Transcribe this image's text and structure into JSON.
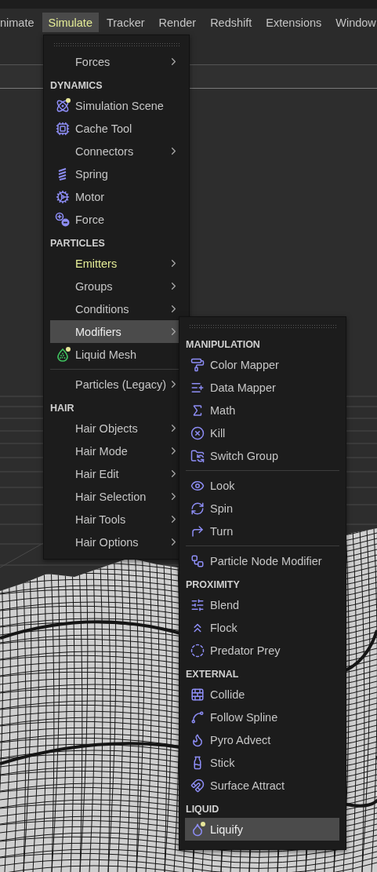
{
  "menubar": [
    {
      "label": "nimate",
      "selected": false
    },
    {
      "label": "Simulate",
      "selected": true
    },
    {
      "label": "Tracker",
      "selected": false
    },
    {
      "label": "Render",
      "selected": false
    },
    {
      "label": "Redshift",
      "selected": false
    },
    {
      "label": "Extensions",
      "selected": false
    },
    {
      "label": "Window",
      "selected": false
    }
  ],
  "simulate_menu": {
    "entries": [
      {
        "kind": "grip"
      },
      {
        "kind": "item",
        "label": "Forces",
        "submenu": true,
        "selected": false,
        "highlighted": false
      },
      {
        "kind": "header",
        "label": "DYNAMICS"
      },
      {
        "kind": "item",
        "label": "Simulation Scene",
        "submenu": false,
        "selected": false,
        "highlighted": false
      },
      {
        "kind": "item",
        "label": "Cache Tool",
        "submenu": false,
        "selected": false,
        "highlighted": false
      },
      {
        "kind": "item",
        "label": "Connectors",
        "submenu": true,
        "selected": false,
        "highlighted": false
      },
      {
        "kind": "item",
        "label": "Spring",
        "submenu": false,
        "selected": false,
        "highlighted": false
      },
      {
        "kind": "item",
        "label": "Motor",
        "submenu": false,
        "selected": false,
        "highlighted": false
      },
      {
        "kind": "item",
        "label": "Force",
        "submenu": false,
        "selected": false,
        "highlighted": false
      },
      {
        "kind": "header",
        "label": "PARTICLES"
      },
      {
        "kind": "item",
        "label": "Emitters",
        "submenu": true,
        "selected": false,
        "highlighted": true
      },
      {
        "kind": "item",
        "label": "Groups",
        "submenu": true,
        "selected": false,
        "highlighted": false
      },
      {
        "kind": "item",
        "label": "Conditions",
        "submenu": true,
        "selected": false,
        "highlighted": false
      },
      {
        "kind": "item",
        "label": "Modifiers",
        "submenu": true,
        "selected": true,
        "highlighted": false
      },
      {
        "kind": "item",
        "label": "Liquid Mesh",
        "submenu": false,
        "selected": false,
        "highlighted": false
      },
      {
        "kind": "separator"
      },
      {
        "kind": "item",
        "label": "Particles (Legacy)",
        "submenu": true,
        "selected": false,
        "highlighted": false
      },
      {
        "kind": "header",
        "label": "HAIR"
      },
      {
        "kind": "item",
        "label": "Hair Objects",
        "submenu": true,
        "selected": false,
        "highlighted": false
      },
      {
        "kind": "item",
        "label": "Hair Mode",
        "submenu": true,
        "selected": false,
        "highlighted": false
      },
      {
        "kind": "item",
        "label": "Hair Edit",
        "submenu": true,
        "selected": false,
        "highlighted": false
      },
      {
        "kind": "item",
        "label": "Hair Selection",
        "submenu": true,
        "selected": false,
        "highlighted": false
      },
      {
        "kind": "item",
        "label": "Hair Tools",
        "submenu": true,
        "selected": false,
        "highlighted": false
      },
      {
        "kind": "item",
        "label": "Hair Options",
        "submenu": true,
        "selected": false,
        "highlighted": false
      }
    ]
  },
  "modifiers_menu": {
    "entries": [
      {
        "kind": "grip"
      },
      {
        "kind": "header",
        "label": "MANIPULATION"
      },
      {
        "kind": "item",
        "label": "Color Mapper",
        "selected": false
      },
      {
        "kind": "item",
        "label": "Data Mapper",
        "selected": false
      },
      {
        "kind": "item",
        "label": "Math",
        "selected": false
      },
      {
        "kind": "item",
        "label": "Kill",
        "selected": false
      },
      {
        "kind": "item",
        "label": "Switch Group",
        "selected": false
      },
      {
        "kind": "separator"
      },
      {
        "kind": "item",
        "label": "Look",
        "selected": false
      },
      {
        "kind": "item",
        "label": "Spin",
        "selected": false
      },
      {
        "kind": "item",
        "label": "Turn",
        "selected": false
      },
      {
        "kind": "separator"
      },
      {
        "kind": "item",
        "label": "Particle Node Modifier",
        "selected": false
      },
      {
        "kind": "header",
        "label": "PROXIMITY"
      },
      {
        "kind": "item",
        "label": "Blend",
        "selected": false
      },
      {
        "kind": "item",
        "label": "Flock",
        "selected": false
      },
      {
        "kind": "item",
        "label": "Predator Prey",
        "selected": false
      },
      {
        "kind": "header",
        "label": "EXTERNAL"
      },
      {
        "kind": "item",
        "label": "Collide",
        "selected": false
      },
      {
        "kind": "item",
        "label": "Follow Spline",
        "selected": false
      },
      {
        "kind": "item",
        "label": "Pyro Advect",
        "selected": false
      },
      {
        "kind": "item",
        "label": "Stick",
        "selected": false
      },
      {
        "kind": "item",
        "label": "Surface Attract",
        "selected": false
      },
      {
        "kind": "header",
        "label": "LIQUID"
      },
      {
        "kind": "item",
        "label": "Liquify",
        "selected": true
      }
    ]
  }
}
